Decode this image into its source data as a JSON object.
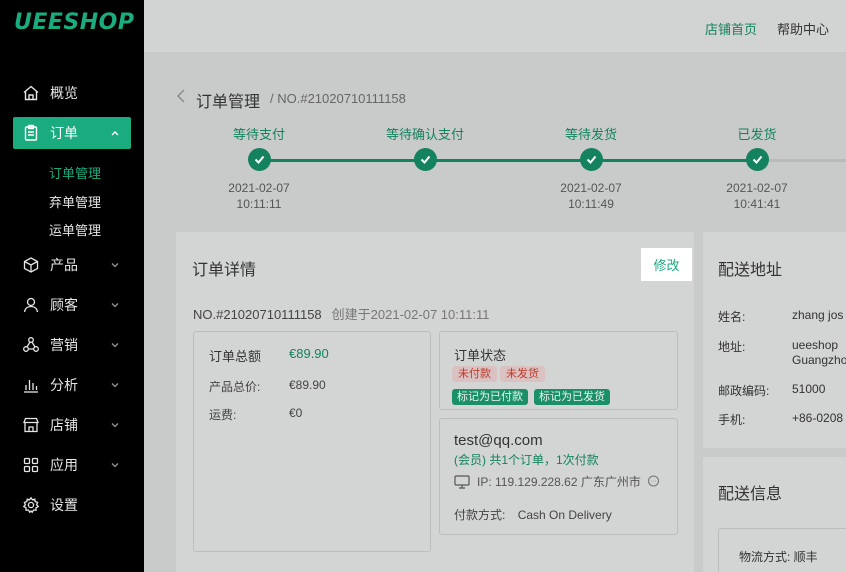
{
  "brand": {
    "logo": "UEESHOP",
    "accent": "#1aab7e"
  },
  "sidebar": {
    "items": [
      {
        "label": "概览",
        "icon": "home-icon"
      },
      {
        "label": "订单",
        "icon": "clipboard-icon",
        "active": true
      },
      {
        "label": "产品",
        "icon": "cube-icon"
      },
      {
        "label": "顾客",
        "icon": "user-icon"
      },
      {
        "label": "营销",
        "icon": "share-icon"
      },
      {
        "label": "分析",
        "icon": "bar-chart-icon"
      },
      {
        "label": "店铺",
        "icon": "store-icon"
      },
      {
        "label": "应用",
        "icon": "apps-icon"
      },
      {
        "label": "设置",
        "icon": "gear-icon"
      }
    ],
    "sub_items": [
      "订单管理",
      "弃单管理",
      "运单管理"
    ]
  },
  "header": {
    "link_home": "店铺首页",
    "link_help": "帮助中心"
  },
  "breadcrumb": {
    "title": "订单管理",
    "order_no": "/ NO.#21020710111158"
  },
  "steps": [
    {
      "label": "等待支付",
      "date": "2021-02-07",
      "time": "10:11:11"
    },
    {
      "label": "等待确认支付",
      "date": "",
      "time": ""
    },
    {
      "label": "等待发货",
      "date": "2021-02-07",
      "time": "10:11:49"
    },
    {
      "label": "已发货",
      "date": "2021-02-07",
      "time": "10:41:41"
    }
  ],
  "order_detail": {
    "title": "订单详情",
    "edit_label": "修改",
    "order_no": "NO.#21020710111158",
    "created": "创建于2021-02-07 10:11:11",
    "total_label": "订单总额",
    "total_value": "€89.90",
    "product_total_label": "产品总价:",
    "product_total_value": "€89.90",
    "shipping_label": "运费:",
    "shipping_value": "€0",
    "status_title": "订单状态",
    "status_tags": [
      "未付款",
      "未发货"
    ],
    "action_tags": [
      "标记为已付款",
      "标记为已发货"
    ],
    "customer_email": "test@qq.com",
    "customer_member": "(会员) 共1个订单，1次付款",
    "customer_ip": "IP: 119.129.228.62 广东广州市",
    "payment_label": "付款方式:",
    "payment_value": "Cash On Delivery"
  },
  "shipping_address": {
    "title": "配送地址",
    "name_label": "姓名:",
    "name_value": "zhang jos",
    "address_label": "地址:",
    "address_line1": "ueeshop",
    "address_line2": "Guangzho",
    "zip_label": "邮政编码:",
    "zip_value": "51000",
    "phone_label": "手机:",
    "phone_value": "+86-0208"
  },
  "shipping_info": {
    "title": "配送信息",
    "method_label": "物流方式: 顺丰"
  }
}
